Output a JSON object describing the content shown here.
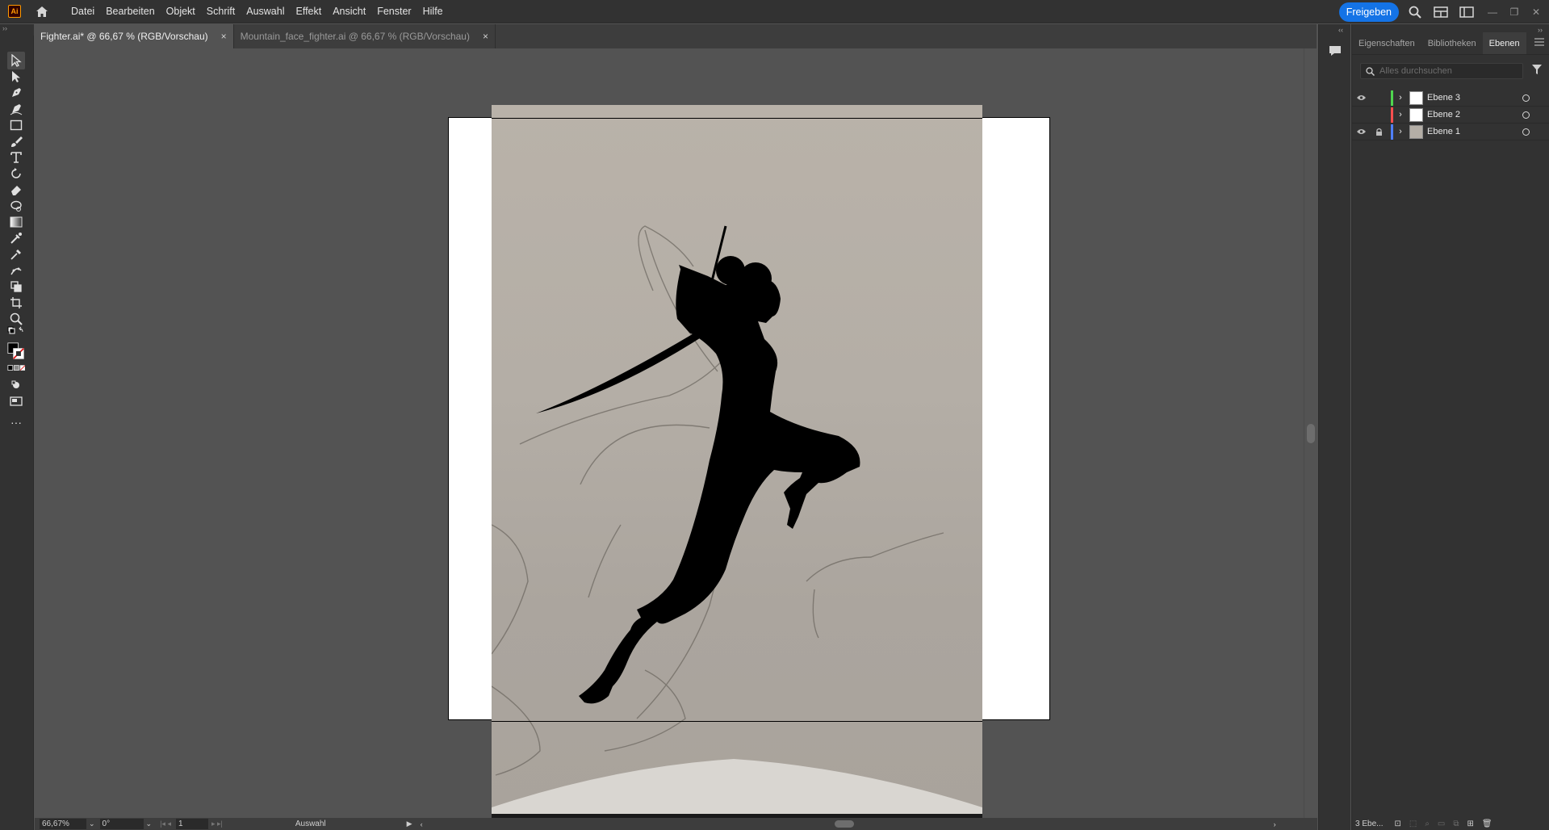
{
  "app": {
    "logo_text": "Ai"
  },
  "menu": [
    "Datei",
    "Bearbeiten",
    "Objekt",
    "Schrift",
    "Auswahl",
    "Effekt",
    "Ansicht",
    "Fenster",
    "Hilfe"
  ],
  "share_label": "Freigeben",
  "tabs": [
    {
      "label": "Fighter.ai* @ 66,67 % (RGB/Vorschau)",
      "close": "×",
      "active": true
    },
    {
      "label": "Mountain_face_fighter.ai @ 66,67 % (RGB/Vorschau)",
      "close": "×",
      "active": false
    }
  ],
  "toolbar": {
    "top_arrows": "››",
    "tools": [
      "selection-tool-icon",
      "direct-selection-tool-icon",
      "pen-tool-icon",
      "curvature-tool-icon",
      "rectangle-tool-icon",
      "paintbrush-tool-icon",
      "type-tool-icon",
      "rotate-tool-icon",
      "eraser-tool-icon",
      "lasso-shape-tool-icon",
      "gradient-tool-icon",
      "eyedropper-blend-icon",
      "eyedropper-tool-icon",
      "puppet-warp-tool-icon",
      "shape-builder-icon",
      "artboard-tool-icon",
      "zoom-tool-icon"
    ],
    "more": "···"
  },
  "panel": {
    "tabs": [
      "Eigenschaften",
      "Bibliotheken",
      "Ebenen"
    ],
    "active_tab": "Ebenen",
    "search_placeholder": "Alles durchsuchen",
    "layers": [
      {
        "name": "Ebene 3",
        "color": "#4fd64f",
        "visible": true,
        "locked": false
      },
      {
        "name": "Ebene 2",
        "color": "#ff4f4f",
        "visible": false,
        "locked": false
      },
      {
        "name": "Ebene 1",
        "color": "#4f7fff",
        "visible": true,
        "locked": true
      }
    ],
    "footer_label": "3 Ebe..."
  },
  "status": {
    "zoom": "66,67%",
    "rotation": "0°",
    "artboard": "1",
    "mode": "Auswahl"
  },
  "collapse_left": "‹‹",
  "collapse_right": "››"
}
